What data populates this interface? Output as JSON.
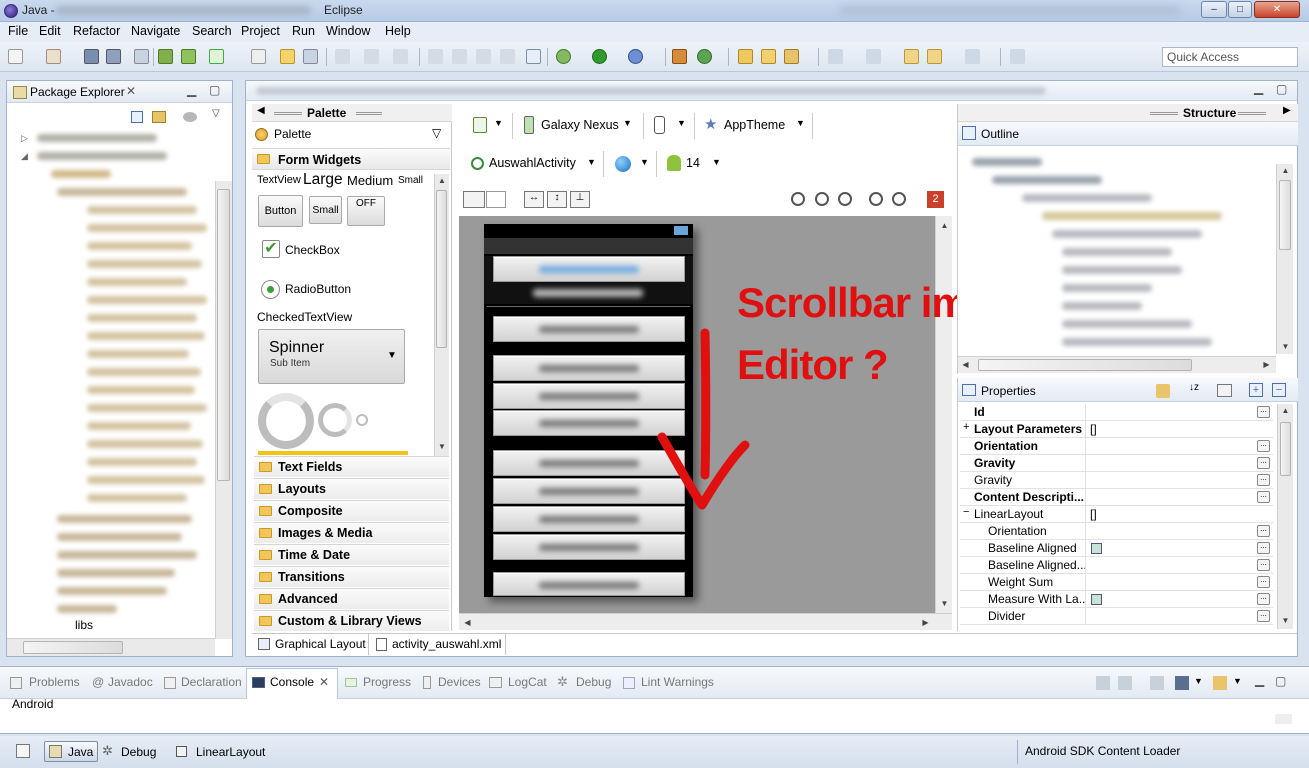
{
  "window": {
    "title_prefix": "Java -",
    "title_app": "Eclipse",
    "minimize": "–",
    "maximize": "□",
    "close": "✕"
  },
  "menu": [
    "File",
    "Edit",
    "Refactor",
    "Navigate",
    "Search",
    "Project",
    "Run",
    "Window",
    "Help"
  ],
  "quick_access": {
    "placeholder": "Quick Access"
  },
  "package_explorer": {
    "title": "Package Explorer",
    "visible_item": "libs"
  },
  "palette": {
    "header": "Palette",
    "dropdown": "Palette",
    "sections": {
      "form_widgets": "Form Widgets",
      "text_sizes": {
        "textview": "TextView",
        "large": "Large",
        "medium": "Medium",
        "small": "Small"
      },
      "buttons": {
        "button": "Button",
        "small": "Small",
        "toggle": "OFF"
      },
      "checkbox": "CheckBox",
      "radio": "RadioButton",
      "checked_textview": "CheckedTextView",
      "spinner": {
        "title": "Spinner",
        "sub": "Sub Item"
      }
    },
    "categories": [
      "Text Fields",
      "Layouts",
      "Composite",
      "Images & Media",
      "Time & Date",
      "Transitions",
      "Advanced",
      "Custom & Library Views"
    ]
  },
  "editor": {
    "device": "Galaxy Nexus",
    "theme": "AppTheme",
    "activity": "AuswahlActivity",
    "api_level": "14",
    "error_count": "2",
    "annotation": {
      "line1": "Scrollbar im",
      "line2": "Editor ?"
    },
    "tabs": {
      "graphical": "Graphical Layout",
      "xml": "activity_auswahl.xml"
    }
  },
  "structure": {
    "header": "Structure",
    "outline": "Outline"
  },
  "properties": {
    "title": "Properties",
    "rows": [
      {
        "name": "Id",
        "bold": true,
        "value": "",
        "dots": true
      },
      {
        "name": "Layout Parameters",
        "bold": true,
        "value": "[]",
        "expand": "+",
        "dots": false
      },
      {
        "name": "Orientation",
        "bold": true,
        "value": "",
        "dots": true
      },
      {
        "name": "Gravity",
        "bold": true,
        "value": "",
        "dots": true
      },
      {
        "name": "Gravity",
        "bold": false,
        "value": "",
        "dots": true
      },
      {
        "name": "Content Descripti...",
        "bold": true,
        "value": "",
        "dots": true
      },
      {
        "name": "LinearLayout",
        "bold": false,
        "value": "[]",
        "expand": "−",
        "dots": false
      },
      {
        "name": "Orientation",
        "bold": false,
        "indent": true,
        "value": "",
        "dots": true
      },
      {
        "name": "Baseline Aligned",
        "bold": false,
        "indent": true,
        "check": true,
        "dots": true
      },
      {
        "name": "Baseline Aligned...",
        "bold": false,
        "indent": true,
        "value": "",
        "dots": true
      },
      {
        "name": "Weight Sum",
        "bold": false,
        "indent": true,
        "value": "",
        "dots": true
      },
      {
        "name": "Measure With La...",
        "bold": false,
        "indent": true,
        "check": true,
        "dots": true
      },
      {
        "name": "Divider",
        "bold": false,
        "indent": true,
        "value": "",
        "dots": true
      }
    ]
  },
  "bottom_tabs": [
    "Problems",
    "Javadoc",
    "Declaration",
    "Console",
    "Progress",
    "Devices",
    "LogCat",
    "Debug",
    "Lint Warnings"
  ],
  "console": {
    "content": "Android"
  },
  "status": {
    "perspective_java": "Java",
    "perspective_debug": "Debug",
    "selection": "LinearLayout",
    "task": "Android SDK Content Loader"
  },
  "colors": {
    "annotation_red": "#e01010",
    "eclipse_chrome": "#d9e3ef",
    "canvas_gray": "#9a9a9a"
  }
}
